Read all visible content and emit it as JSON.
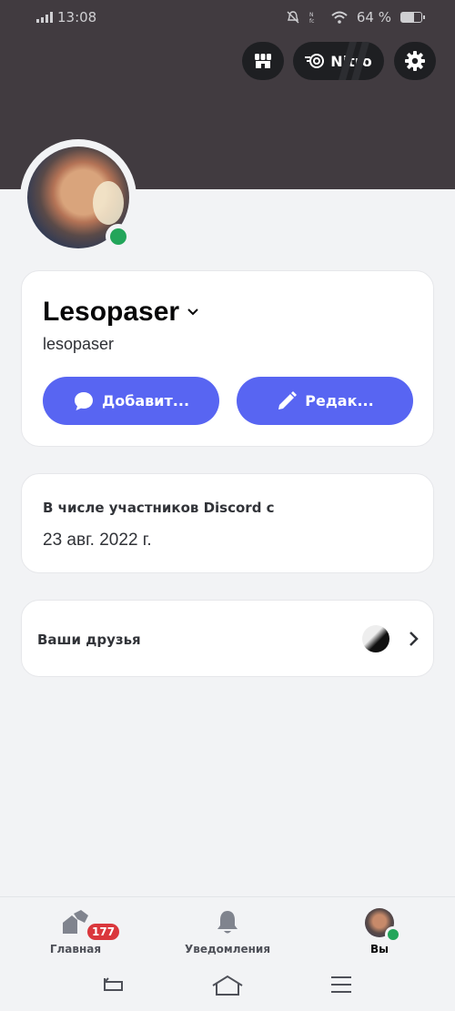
{
  "status_bar": {
    "time": "13:08",
    "battery_text": "64 %",
    "battery_level": 0.64
  },
  "header": {
    "nitro_label": "Nitro"
  },
  "profile": {
    "display_name": "Lesopaser",
    "username": "lesopaser",
    "status": "online",
    "add_button_label": "Добавит...",
    "edit_button_label": "Редак..."
  },
  "member_since": {
    "title": "В числе участников Discord с",
    "date": "23 авг. 2022 г."
  },
  "friends": {
    "label": "Ваши друзья"
  },
  "bottom_nav": {
    "home_label": "Главная",
    "home_badge": "177",
    "notifications_label": "Уведомления",
    "you_label": "Вы"
  },
  "colors": {
    "banner": "#413b40",
    "accent": "#5865f2",
    "online": "#23a55a",
    "badge": "#da373c"
  },
  "icons": {
    "shop": "shop-icon",
    "nitro": "nitro-icon",
    "settings": "gear-icon",
    "add": "chat-bubble-icon",
    "edit": "pencil-icon",
    "chevron": "chevron-right-icon",
    "home": "home-icon",
    "notifications": "bell-icon"
  }
}
